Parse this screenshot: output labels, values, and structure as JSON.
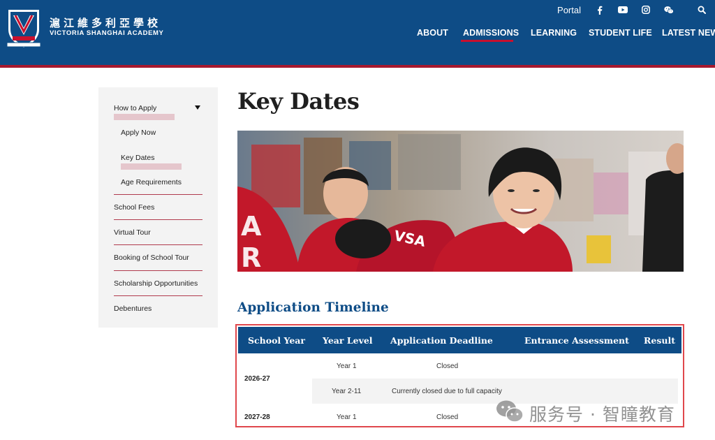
{
  "header": {
    "school_name_cn": "滬江維多利亞學校",
    "school_name_en": "VICTORIA SHANGHAI ACADEMY",
    "portal_label": "Portal",
    "brand_color": "#0e4c86",
    "accent_color": "#a6192e",
    "utility_icons": [
      "facebook-icon",
      "youtube-icon",
      "instagram-icon",
      "wechat-icon",
      "search-icon"
    ],
    "nav": [
      {
        "label": "ABOUT"
      },
      {
        "label": "ADMISSIONS",
        "active": true
      },
      {
        "label": "LEARNING"
      },
      {
        "label": "STUDENT LIFE"
      },
      {
        "label": "LATEST NEWS"
      }
    ]
  },
  "sidebar": {
    "how_to_apply": "How to Apply",
    "apply_now": "Apply Now",
    "key_dates": "Key Dates",
    "age_requirements": "Age Requirements",
    "school_fees": "School Fees",
    "virtual_tour": "Virtual Tour",
    "booking_tour": "Booking of School Tour",
    "scholarship": "Scholarship Opportunities",
    "debentures": "Debentures"
  },
  "main": {
    "title": "Key Dates",
    "section_title": "Application Timeline",
    "table": {
      "headers": [
        "School Year",
        "Year Level",
        "Application Deadline",
        "Entrance Assessment",
        "Result"
      ],
      "rows": [
        {
          "school_year": "2026-27",
          "year_level": "Year 1",
          "deadline": "Closed"
        },
        {
          "school_year": "",
          "year_level": "Year 2-11",
          "deadline": "Currently closed due to full capacity"
        },
        {
          "school_year": "2027-28",
          "year_level": "Year 1",
          "deadline": "Closed"
        }
      ]
    }
  },
  "watermark": {
    "text": "服务号 · 智瞳教育"
  }
}
